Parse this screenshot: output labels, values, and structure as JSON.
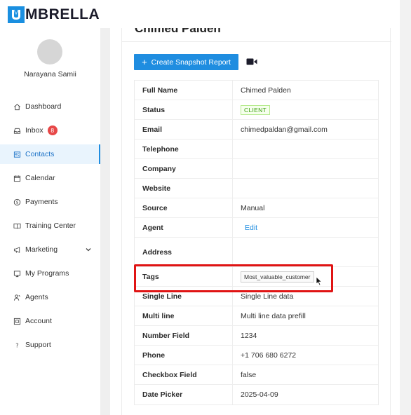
{
  "brand": {
    "logo_letter": "U",
    "logo_text": "MBRELLA",
    "accent": "#1f8de0"
  },
  "user": {
    "name": "Narayana Samii"
  },
  "sidebar": {
    "items": [
      {
        "label": "Dashboard",
        "icon": "home-icon"
      },
      {
        "label": "Inbox",
        "icon": "inbox-icon",
        "badge": "8"
      },
      {
        "label": "Contacts",
        "icon": "contacts-icon",
        "active": true
      },
      {
        "label": "Calendar",
        "icon": "calendar-icon"
      },
      {
        "label": "Payments",
        "icon": "dollar-icon"
      },
      {
        "label": "Training Center",
        "icon": "book-icon"
      },
      {
        "label": "Marketing",
        "icon": "megaphone-icon",
        "has_submenu": true
      },
      {
        "label": "My Programs",
        "icon": "monitor-icon"
      },
      {
        "label": "Agents",
        "icon": "agents-icon"
      },
      {
        "label": "Account",
        "icon": "account-icon"
      },
      {
        "label": "Support",
        "icon": "question-icon"
      }
    ]
  },
  "contact": {
    "title": "Chimed Palden",
    "create_report_label": "Create Snapshot Report",
    "fields": [
      {
        "label": "Full Name",
        "value": "Chimed Palden"
      },
      {
        "label": "Status",
        "value": "CLIENT"
      },
      {
        "label": "Email",
        "value": "chimedpaldan@gmail.com"
      },
      {
        "label": "Telephone",
        "value": ""
      },
      {
        "label": "Company",
        "value": ""
      },
      {
        "label": "Website",
        "value": ""
      },
      {
        "label": "Source",
        "value": "Manual"
      },
      {
        "label": "Agent",
        "value": "Edit"
      },
      {
        "label": "Address",
        "value": ""
      },
      {
        "label": "Tags",
        "value": "Most_valuable_customer"
      },
      {
        "label": "Single Line",
        "value": "Single Line data"
      },
      {
        "label": "Multi line",
        "value": "Multi line data prefill"
      },
      {
        "label": "Number Field",
        "value": "1234"
      },
      {
        "label": "Phone",
        "value": "+1 706 680 6272"
      },
      {
        "label": "Checkbox Field",
        "value": "false"
      },
      {
        "label": "Date Picker",
        "value": "2025-04-09"
      }
    ]
  },
  "colors": {
    "highlight": "#e01414",
    "client_tag": "#389e0d",
    "badge": "#e74848"
  }
}
